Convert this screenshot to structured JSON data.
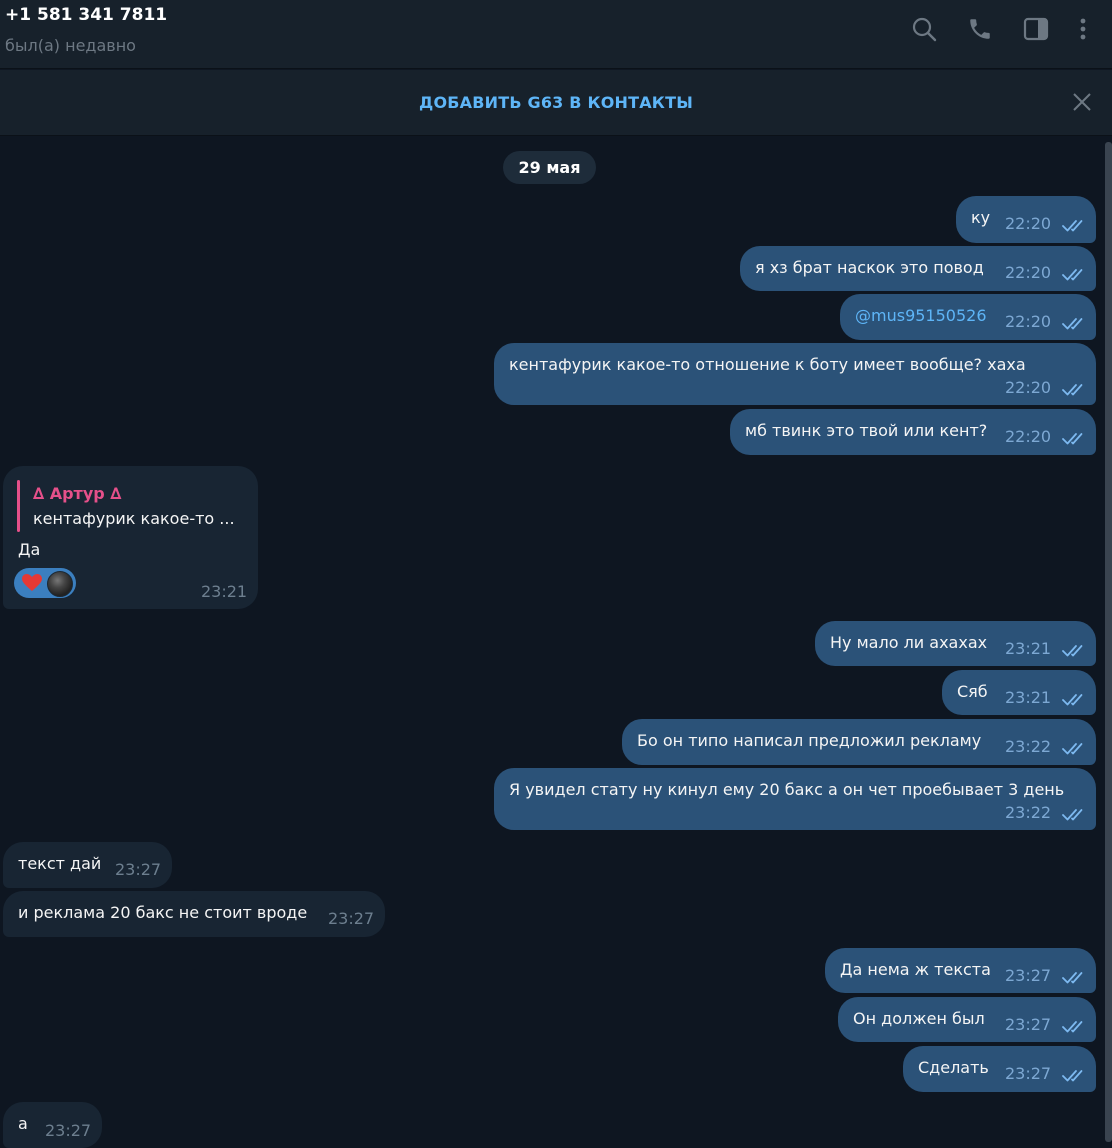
{
  "header": {
    "contact_name": "+1 581 341 7811",
    "status": "был(а) недавно",
    "icons": [
      "search-icon",
      "phone-icon",
      "sidebar-toggle-icon",
      "more-vertical-icon"
    ]
  },
  "banner": {
    "add_contact_label": "ДОБАВИТЬ G63 В КОНТАКТЫ"
  },
  "date_separator": "29 мая",
  "colors": {
    "background": "#0e1621",
    "outgoing_bubble": "#2b5278",
    "incoming_bubble": "#182533",
    "accent": "#5eb5f7",
    "reply_accent": "#e5508a"
  },
  "messages": [
    {
      "dir": "out",
      "text": "ку",
      "time": "22:20"
    },
    {
      "dir": "out",
      "text": "я хз брат наскок это повод",
      "time": "22:20"
    },
    {
      "dir": "out",
      "text": "@mus95150526",
      "time": "22:20"
    },
    {
      "dir": "out",
      "text": "кентафурик какое-то отношение к боту имеет вообще? хаха",
      "time": "22:20"
    },
    {
      "dir": "out",
      "text": "мб твинк это твой или кент?",
      "time": "22:20"
    },
    {
      "dir": "in",
      "reply_author": "∆ Артур ∆",
      "reply_text": "кентафурик какое-то ...",
      "text": "Да",
      "time": "23:21",
      "reaction": "heart-icon"
    },
    {
      "dir": "out",
      "text": "Ну мало ли ахахах",
      "time": "23:21"
    },
    {
      "dir": "out",
      "text": "Сяб",
      "time": "23:21"
    },
    {
      "dir": "out",
      "text": "Бо он типо написал предложил рекламу",
      "time": "23:22"
    },
    {
      "dir": "out",
      "text": "Я увидел стату ну кинул ему 20 бакс а он чет проебывает 3 день",
      "time": "23:22"
    },
    {
      "dir": "in",
      "text": "текст дай",
      "time": "23:27"
    },
    {
      "dir": "in",
      "text": "и реклама 20 бакс не стоит вроде",
      "time": "23:27"
    },
    {
      "dir": "out",
      "text": "Да нема ж текста",
      "time": "23:27"
    },
    {
      "dir": "out",
      "text": "Он должен был",
      "time": "23:27"
    },
    {
      "dir": "out",
      "text": "Сделать",
      "time": "23:27"
    },
    {
      "dir": "in",
      "text": "а",
      "time": "23:27"
    }
  ]
}
